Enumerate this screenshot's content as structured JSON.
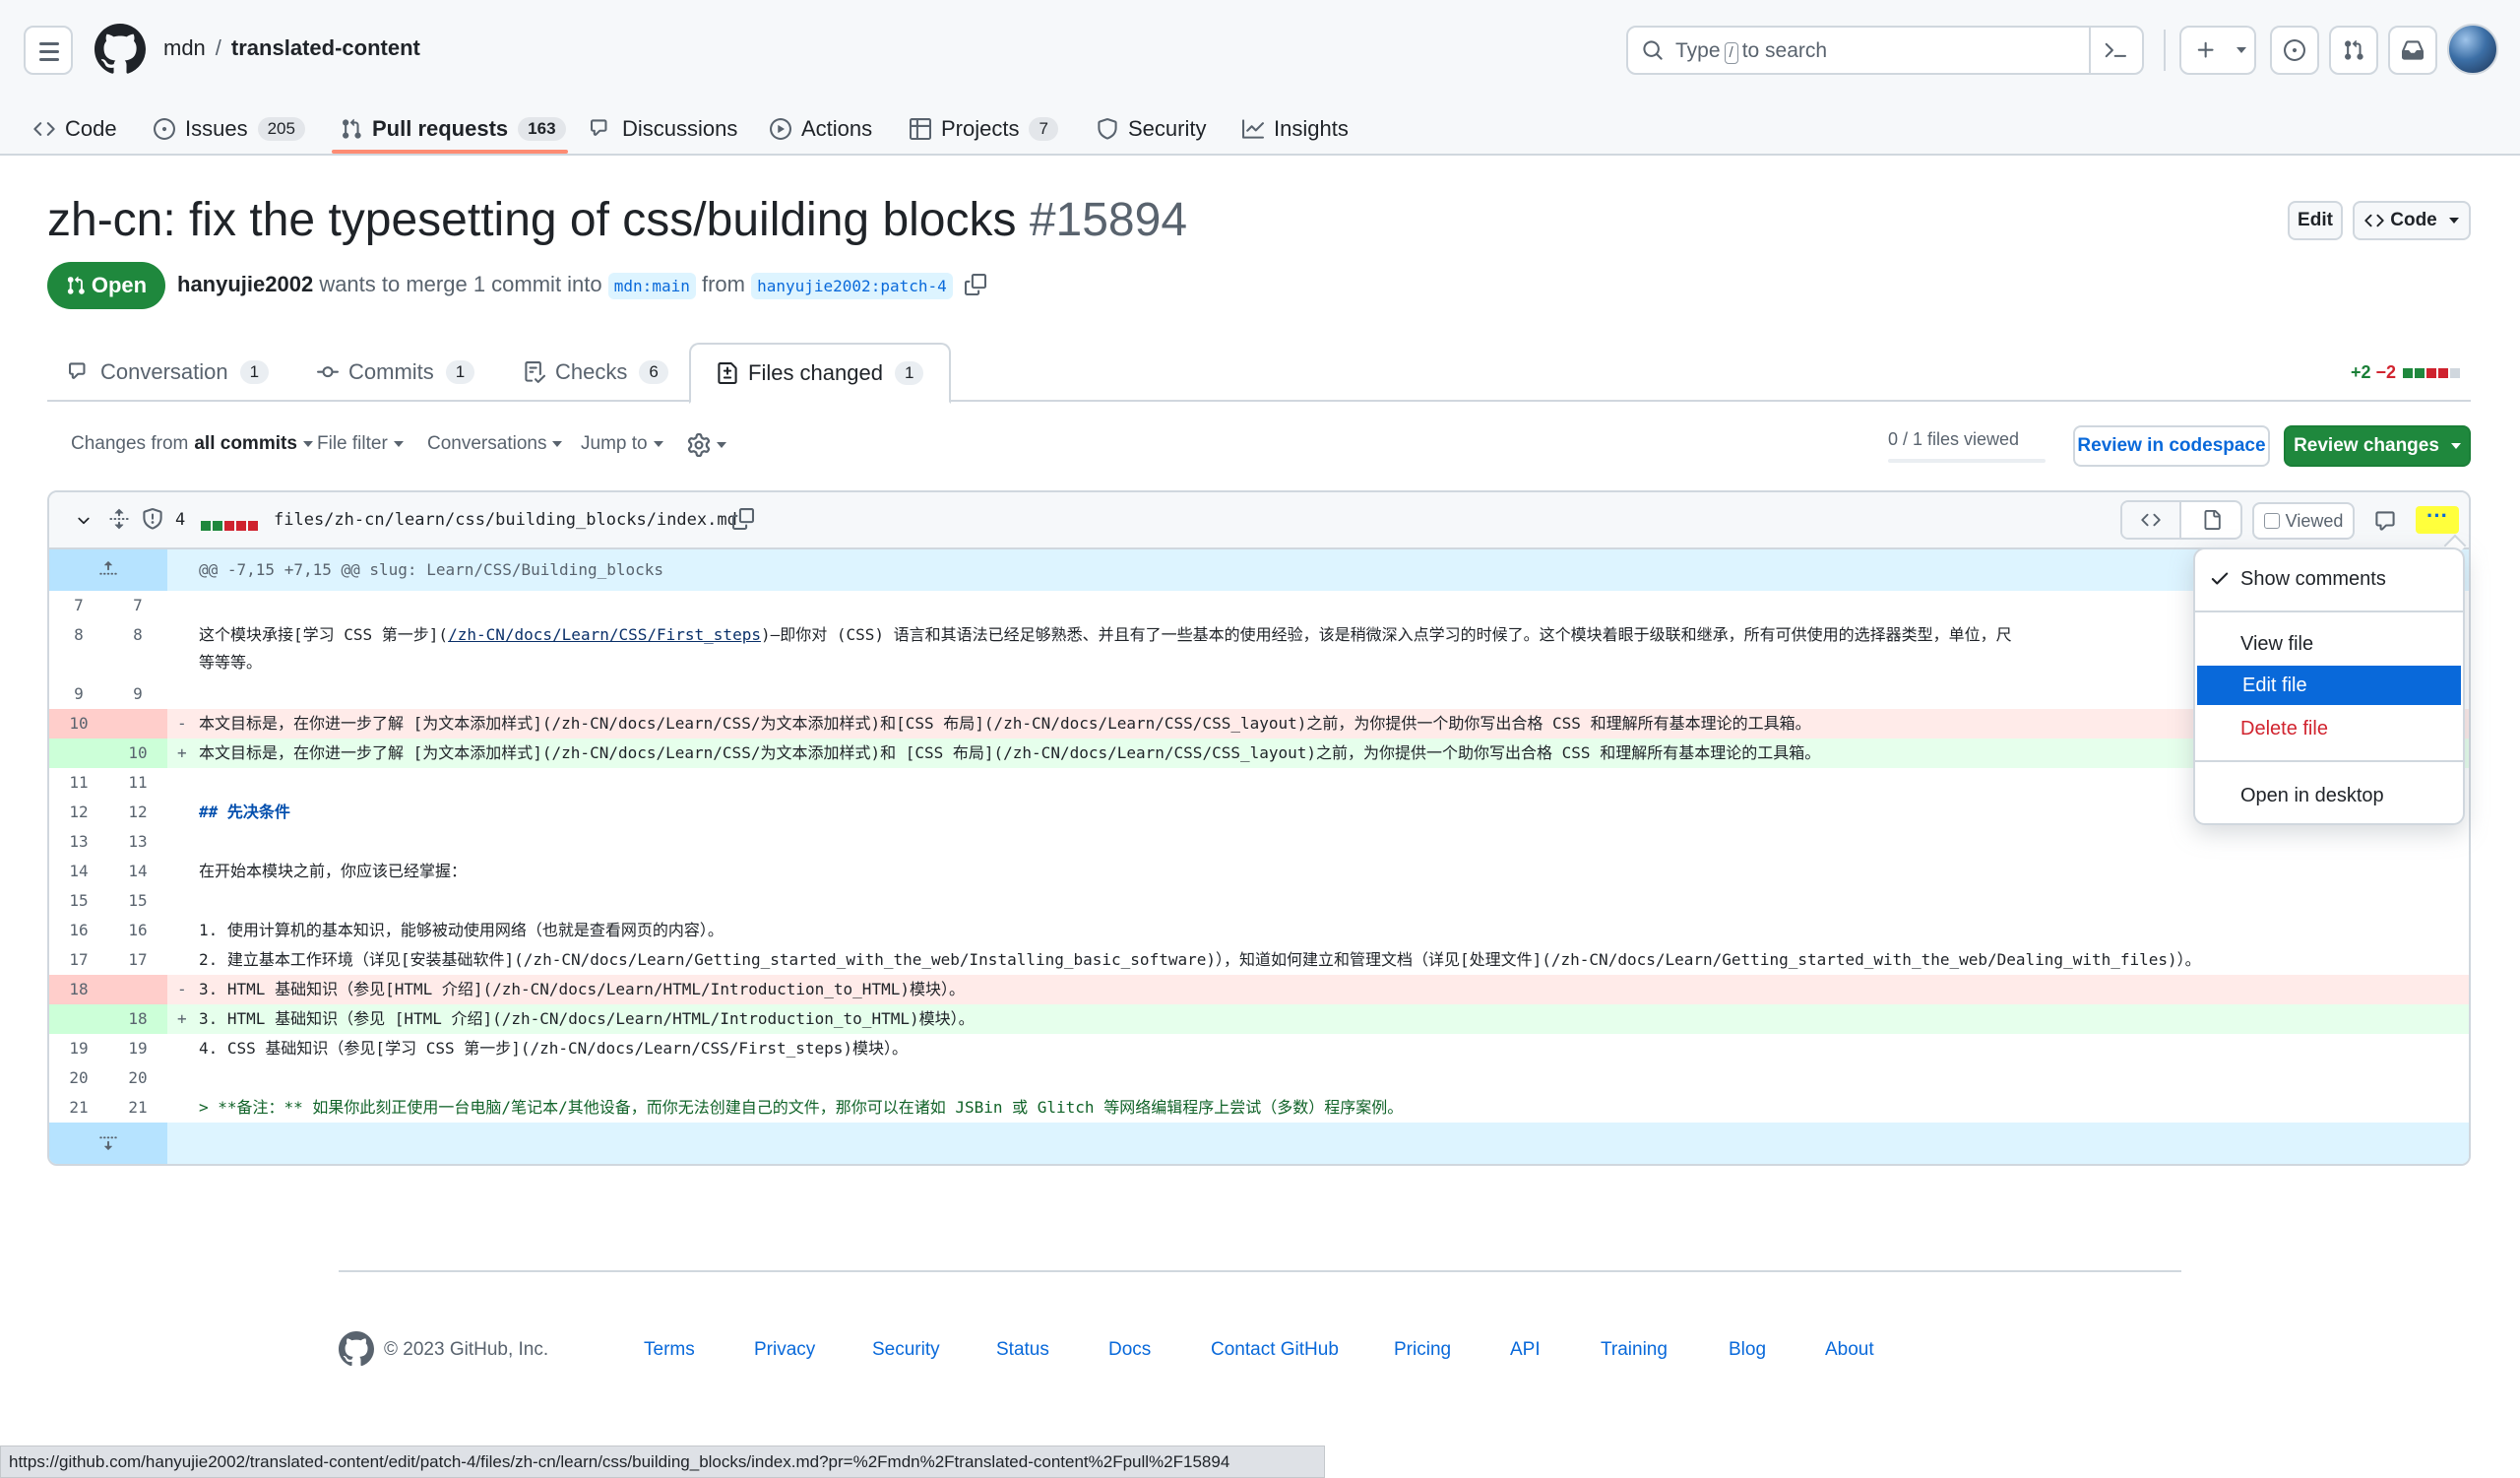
{
  "header": {
    "owner": "mdn",
    "separator": "/",
    "repo": "translated-content",
    "search": {
      "prefix": "Type",
      "key": "/",
      "suffix": "to search"
    }
  },
  "nav": [
    {
      "label": "Code",
      "icon": "code-icon"
    },
    {
      "label": "Issues",
      "icon": "issue-icon",
      "count": "205"
    },
    {
      "label": "Pull requests",
      "icon": "pull-request-icon",
      "count": "163",
      "active": true
    },
    {
      "label": "Discussions",
      "icon": "discussion-icon"
    },
    {
      "label": "Actions",
      "icon": "play-icon"
    },
    {
      "label": "Projects",
      "icon": "table-icon",
      "count": "7"
    },
    {
      "label": "Security",
      "icon": "shield-icon"
    },
    {
      "label": "Insights",
      "icon": "graph-icon"
    }
  ],
  "pr": {
    "title": "zh-cn: fix the typesetting of css/building blocks",
    "number": "#15894",
    "state": "Open",
    "author": "hanyujie2002",
    "meta_middle": "wants to merge 1 commit into",
    "base": "mdn:main",
    "from": "from",
    "head": "hanyujie2002:patch-4",
    "edit_label": "Edit",
    "code_label": "Code"
  },
  "tabs": [
    {
      "label": "Conversation",
      "count": "1",
      "icon": "comment-icon"
    },
    {
      "label": "Commits",
      "count": "1",
      "icon": "commit-icon"
    },
    {
      "label": "Checks",
      "count": "6",
      "icon": "checklist-icon"
    },
    {
      "label": "Files changed",
      "count": "1",
      "icon": "file-diff-icon",
      "active": true
    }
  ],
  "diffstat": {
    "additions": "+2",
    "deletions": "−2"
  },
  "toolbar": {
    "changes_prefix": "Changes from",
    "changes_value": "all commits",
    "file_filter": "File filter",
    "conversations": "Conversations",
    "jump_to": "Jump to",
    "files_viewed": "0 / 1 files viewed",
    "review_codespace": "Review in codespace",
    "review_changes": "Review changes"
  },
  "file": {
    "changes": "4",
    "path": "files/zh-cn/learn/css/building_blocks/index.md",
    "viewed_label": "Viewed",
    "kebab": "···"
  },
  "diff": {
    "hunk": "@@ -7,15 +7,15 @@ slug: Learn/CSS/Building_blocks",
    "lines": [
      {
        "old": "7",
        "new": "7",
        "type": "ctx",
        "text": ""
      },
      {
        "old": "8",
        "new": "8",
        "type": "ctx",
        "text_a": "这个模块承接[学习 CSS 第一步](",
        "link_a": "/zh-CN/docs/Learn/CSS/First_steps",
        "text_b": ")—即你对 (CSS) 语言和其语法已经足够熟悉、并且有了一些基本的使用经验，该是稍微深入点学习的时候了。这个模块着眼于级联和继承，所有可供使用的选择器类型，单位，尺",
        "cont": "等等等。"
      },
      {
        "old": "9",
        "new": "9",
        "type": "ctx",
        "text": ""
      },
      {
        "old": "10",
        "new": "",
        "type": "del",
        "text": "本文目标是，在你进一步了解 [为文本添加样式](/zh-CN/docs/Learn/CSS/为文本添加样式)和[CSS 布局](/zh-CN/docs/Learn/CSS/CSS_layout)之前，为你提供一个助你写出合格 CSS 和理解所有基本理论的工具箱。"
      },
      {
        "old": "",
        "new": "10",
        "type": "add",
        "text": "本文目标是，在你进一步了解 [为文本添加样式](/zh-CN/docs/Learn/CSS/为文本添加样式)和 [CSS 布局](/zh-CN/docs/Learn/CSS/CSS_layout)之前，为你提供一个助你写出合格 CSS 和理解所有基本理论的工具箱。"
      },
      {
        "old": "11",
        "new": "11",
        "type": "ctx",
        "text": ""
      },
      {
        "old": "12",
        "new": "12",
        "type": "ctx",
        "text": "## 先决条件",
        "heading": true
      },
      {
        "old": "13",
        "new": "13",
        "type": "ctx",
        "text": ""
      },
      {
        "old": "14",
        "new": "14",
        "type": "ctx",
        "text": "在开始本模块之前，你应该已经掌握："
      },
      {
        "old": "15",
        "new": "15",
        "type": "ctx",
        "text": ""
      },
      {
        "old": "16",
        "new": "16",
        "type": "ctx",
        "text": "1. 使用计算机的基本知识，能够被动使用网络（也就是查看网页的内容）。"
      },
      {
        "old": "17",
        "new": "17",
        "type": "ctx",
        "text": "2. 建立基本工作环境（详见[安装基础软件](/zh-CN/docs/Learn/Getting_started_with_the_web/Installing_basic_software)），知道如何建立和管理文档（详见[处理文件](/zh-CN/docs/Learn/Getting_started_with_the_web/Dealing_with_files)）。"
      },
      {
        "old": "18",
        "new": "",
        "type": "del",
        "text": "3. HTML 基础知识（参见[HTML 介绍](/zh-CN/docs/Learn/HTML/Introduction_to_HTML)模块）。"
      },
      {
        "old": "",
        "new": "18",
        "type": "add",
        "text": "3. HTML 基础知识（参见 [HTML 介绍](/zh-CN/docs/Learn/HTML/Introduction_to_HTML)模块）。"
      },
      {
        "old": "19",
        "new": "19",
        "type": "ctx",
        "text": "4. CSS 基础知识（参见[学习 CSS 第一步](/zh-CN/docs/Learn/CSS/First_steps)模块）。"
      },
      {
        "old": "20",
        "new": "20",
        "type": "ctx",
        "text": ""
      },
      {
        "old": "21",
        "new": "21",
        "type": "ctx",
        "text": "> **备注：** 如果你此刻正使用一台电脑/笔记本/其他设备，而你无法创建自己的文件，那你可以在诸如 JSBin 或 Glitch 等网络编辑程序上尝试（多数）程序案例。",
        "quote": true
      }
    ]
  },
  "menu": {
    "show_comments": "Show comments",
    "view_file": "View file",
    "edit_file": "Edit file",
    "delete_file": "Delete file",
    "open_desktop": "Open in desktop"
  },
  "footer": {
    "copyright": "© 2023 GitHub, Inc.",
    "links": [
      "Terms",
      "Privacy",
      "Security",
      "Status",
      "Docs",
      "Contact GitHub",
      "Pricing",
      "API",
      "Training",
      "Blog",
      "About"
    ]
  },
  "status_url": "https://github.com/hanyujie2002/translated-content/edit/patch-4/files/zh-cn/learn/css/building_blocks/index.md?pr=%2Fmdn%2Ftranslated-content%2Fpull%2F15894",
  "colors": {
    "accent": "#0969da",
    "open_green": "#1f883d",
    "add_bg": "#e6ffec",
    "del_bg": "#ffebe9",
    "highlight": "#ffff3c"
  }
}
